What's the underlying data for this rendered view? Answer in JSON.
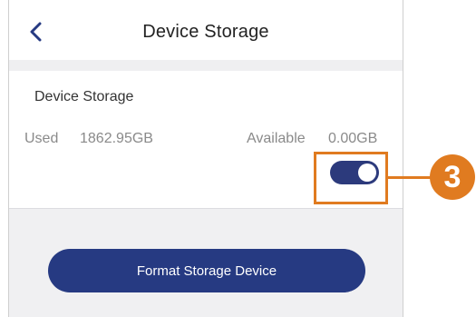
{
  "header": {
    "title": "Device Storage",
    "back_icon": "chevron-left-icon"
  },
  "storage": {
    "section_title": "Device Storage",
    "used_label": "Used",
    "used_value": "1862.95GB",
    "available_label": "Available",
    "available_value": "0.00GB",
    "toggle_on": true
  },
  "actions": {
    "format_label": "Format Storage Device"
  },
  "callout": {
    "number": "3"
  },
  "colors": {
    "accent": "#263a82",
    "callout": "#e07b20",
    "background_gray": "#f0f0f2"
  }
}
